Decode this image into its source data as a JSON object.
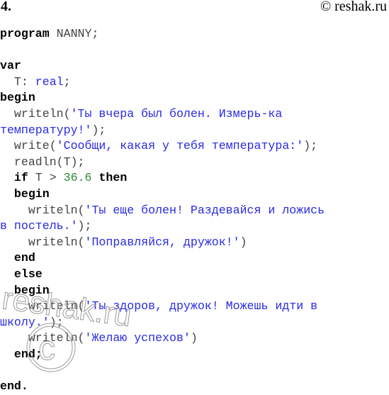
{
  "header": {
    "task_number": "4.",
    "copyright": "© reshak.ru"
  },
  "code": {
    "l1_kw": "program",
    "l1_id": " NANNY;",
    "l3_kw": "var",
    "l4_id": "  T: ",
    "l4_type": "real",
    "l4_end": ";",
    "l5_kw": "begin",
    "l6_pre": "  writeln(",
    "l6_str": "'Ты вчера был болен. Измерь-ка",
    "l7_str": "температуру!'",
    "l7_end": ");",
    "l8_pre": "  write(",
    "l8_str": "'Сообщи, какая у тебя температура:'",
    "l8_end": ");",
    "l9": "  readln(T);",
    "l10_kw1": "if",
    "l10_mid": " T > ",
    "l10_num": "36.6",
    "l10_kw2": "then",
    "l11_kw": "begin",
    "l12_pre": "    writeln(",
    "l12_str": "'Ты еще болен! Раздевайся и ложись",
    "l13_str": "в постель.'",
    "l13_end": ");",
    "l14_pre": "    writeln(",
    "l14_str": "'Поправляйся, дружок!'",
    "l14_end": ")",
    "l15_kw": "end",
    "l16_kw": "else",
    "l17_kw": "begin",
    "l18_pre": "    writeln(",
    "l18_str": "'Ты здоров, дружок! Можешь идти в",
    "l19_str": "школу.'",
    "l19_end": ");",
    "l20_pre": "    writeln(",
    "l20_str": "'Желаю успехов'",
    "l20_end": ")",
    "l21_kw": "end;",
    "l23_kw": "end."
  },
  "watermark": {
    "text": "reshak.ru",
    "symbol": "©"
  },
  "colors": {
    "keyword": "#000000",
    "identifier": "#444444",
    "string": "#2a2ae6",
    "number": "#2e8b3a"
  }
}
